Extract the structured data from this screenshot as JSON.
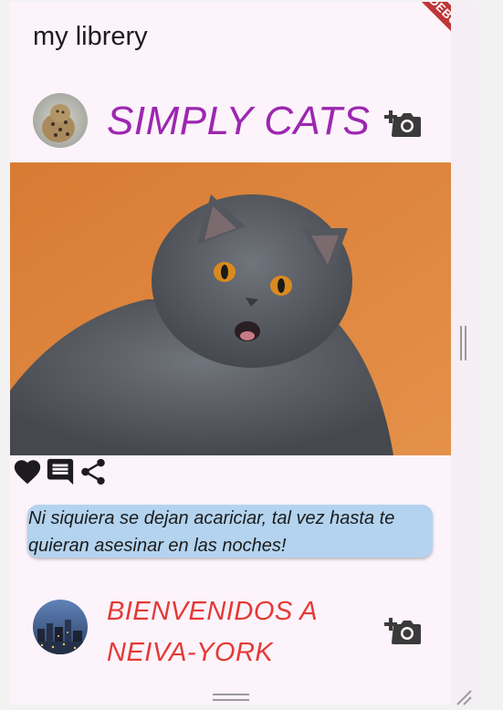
{
  "app": {
    "title": "my librery",
    "debug_banner": "DEBUG"
  },
  "posts": [
    {
      "title": "SIMPLY CATS",
      "title_color": "#9c27b0",
      "avatar_icon": "leopard-avatar",
      "action_icon": "add-a-photo-icon",
      "caption": "Ni siquiera se dejan acariciar, tal vez hasta te quieran asesinar en las noches!",
      "actions": [
        "favorite-icon",
        "comment-icon",
        "share-icon"
      ]
    },
    {
      "title_line1": "BIENVENIDOS A",
      "title_line2": "NEIVA-YORK",
      "title_color": "#e53935",
      "avatar_icon": "city-avatar",
      "action_icon": "add-a-photo-icon"
    }
  ],
  "colors": {
    "caption_bg": "#b3d3ee",
    "page_bg": "#fcf3fb",
    "icon": "#1d1b1e"
  }
}
